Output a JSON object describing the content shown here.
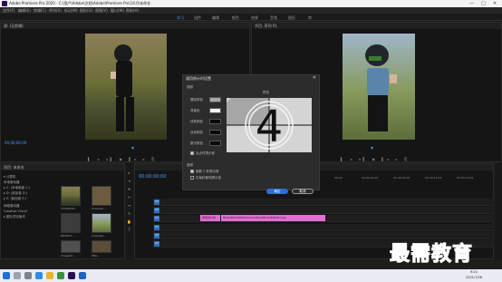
{
  "window": {
    "title": "Adobe Premiere Pro 2020 - C:\\用户\\Adobe\\文档\\Adobe\\Premiere Pro\\14.0\\未命名",
    "controls": [
      "—",
      "□",
      "✕"
    ]
  },
  "menu": [
    "文件(F)",
    "编辑(E)",
    "剪辑(C)",
    "序列(S)",
    "标记(M)",
    "图形(G)",
    "视图(V)",
    "窗口(W)",
    "帮助(H)"
  ],
  "workspaces": {
    "items": [
      "学习",
      "组件",
      "编辑",
      "颜色",
      "效果",
      "音频",
      "图形",
      "库"
    ],
    "active_index": 0
  },
  "source_monitor": {
    "tab": "源: (无剪辑)",
    "timecode": "00;00;00;00",
    "image_desc_icon": "photo-thumbnail-icon"
  },
  "program_monitor": {
    "tab": "节目: 序列 01",
    "timecode": "00;00;00;00"
  },
  "project": {
    "tab": "项目: 未命名",
    "tree": [
      "▾ 计算机",
      "  本地驱动器",
      "   ▸ C: (本地磁盘 C:)",
      "   ▸ D: (新加卷 D:)",
      "   ▸ E: (新加卷 E:)",
      "  网络驱动器",
      "  Creative Cloud",
      "   ▸ 团队项目版本"
    ],
    "thumbs": [
      "20200530...",
      "Snipaste...",
      "BD08C5...",
      "Snipaste...",
      "PNG...",
      "Image00..."
    ]
  },
  "timeline": {
    "timecode": "00;00;00;00",
    "ruler": [
      "00;00",
      "00;00;04;29",
      "00;00;09;29",
      "00;00;14;29",
      "00;00;19;29"
    ],
    "tracks": [
      "V3",
      "V2",
      "V1",
      "A1",
      "A2",
      "A3"
    ],
    "clip1": "通用倒计时...",
    "clip2": "BD2DB55D85B7D2A2A7FA4D8C1CB3E3C7.jpg"
  },
  "dialog": {
    "title": "通用倒计时设置",
    "section_video": "视频",
    "labels": [
      "擦除颜色",
      "背景色",
      "线条颜色",
      "目标颜色",
      "数字颜色"
    ],
    "swatch_colors": [
      "#a8a8a8",
      "#f2f2f2",
      "#0a0a0a",
      "#0a0a0a",
      "#0a0a0a"
    ],
    "preview_label": "预览",
    "preview_number": "4",
    "checkbox_flash": "出点时提示音",
    "section_audio": "音频",
    "checkbox_beep_two": "倒数 2 秒提示音",
    "checkbox_beep_each": "在每秒都响提示音",
    "ok": "确定",
    "cancel": "取消"
  },
  "watermark": "最需教育",
  "taskbar": {
    "time": "9:24",
    "date": "2021/7/28"
  }
}
